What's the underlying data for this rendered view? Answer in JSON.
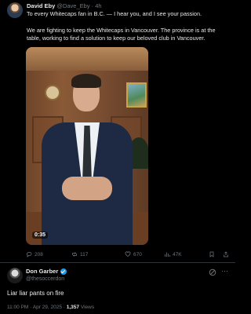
{
  "tweet": {
    "author_name": "David Eby",
    "author_handle": "@Dave_Eby",
    "time": "4h",
    "line1": "To every Whitecaps fan in B.C. — I hear you, and I see your passion.",
    "line2": "We are fighting to keep the Whitecaps in Vancouver. The province is at the table, working to find a solution to keep our beloved club in Vancouver.",
    "video_timestamp": "0:35",
    "replies": "208",
    "reposts": "117",
    "likes": "670",
    "views": "47K"
  },
  "reply": {
    "author_name": "Don Garber",
    "author_handle": "@thesoccerdon",
    "text": "Liar liar pants on fire",
    "time": "11:00 PM · Apr 29, 2025 · ",
    "views_count": "1,357",
    "views_label": " Views"
  },
  "colors": {
    "background": "#000000",
    "text_primary": "#e7e9ea",
    "text_secondary": "#71767b",
    "verified_blue": "#1d9bf0"
  }
}
